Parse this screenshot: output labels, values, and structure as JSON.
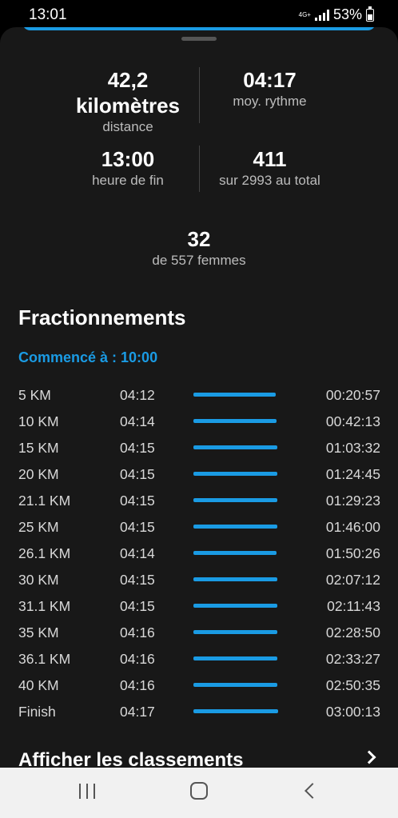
{
  "status_bar": {
    "time": "13:01",
    "network": "4G+",
    "battery": "53%"
  },
  "summary": {
    "distance_value": "42,2",
    "distance_unit": "kilomètres",
    "distance_label": "distance",
    "pace_value": "04:17",
    "pace_label": "moy. rythme",
    "finish_value": "13:00",
    "finish_label": "heure de fin",
    "overall_rank_value": "411",
    "overall_rank_label": "sur 2993 au total",
    "gender_rank_value": "32",
    "gender_rank_label": "de 557 femmes"
  },
  "splits": {
    "title": "Fractionnements",
    "started": "Commencé à : 10:00",
    "accent_color": "#1a9be4",
    "rows": [
      {
        "dist": "5 KM",
        "pace": "04:12",
        "time": "00:20:57",
        "bar": 0.972
      },
      {
        "dist": "10 KM",
        "pace": "04:14",
        "time": "00:42:13",
        "bar": 0.981
      },
      {
        "dist": "15 KM",
        "pace": "04:15",
        "time": "01:03:32",
        "bar": 0.99
      },
      {
        "dist": "20 KM",
        "pace": "04:15",
        "time": "01:24:45",
        "bar": 0.99
      },
      {
        "dist": "21.1 KM",
        "pace": "04:15",
        "time": "01:29:23",
        "bar": 0.99
      },
      {
        "dist": "25 KM",
        "pace": "04:15",
        "time": "01:46:00",
        "bar": 0.99
      },
      {
        "dist": "26.1 KM",
        "pace": "04:14",
        "time": "01:50:26",
        "bar": 0.981
      },
      {
        "dist": "30 KM",
        "pace": "04:15",
        "time": "02:07:12",
        "bar": 0.99
      },
      {
        "dist": "31.1 KM",
        "pace": "04:15",
        "time": "02:11:43",
        "bar": 0.99
      },
      {
        "dist": "35 KM",
        "pace": "04:16",
        "time": "02:28:50",
        "bar": 0.995
      },
      {
        "dist": "36.1 KM",
        "pace": "04:16",
        "time": "02:33:27",
        "bar": 0.995
      },
      {
        "dist": "40 KM",
        "pace": "04:16",
        "time": "02:50:35",
        "bar": 0.995
      },
      {
        "dist": "Finish",
        "pace": "04:17",
        "time": "03:00:13",
        "bar": 1.0
      }
    ]
  },
  "rankings_link": {
    "label": "Afficher les classements"
  },
  "nav_bar": {
    "recent_icon": "recent-apps-icon",
    "home_icon": "home-icon",
    "back_icon": "back-icon"
  }
}
